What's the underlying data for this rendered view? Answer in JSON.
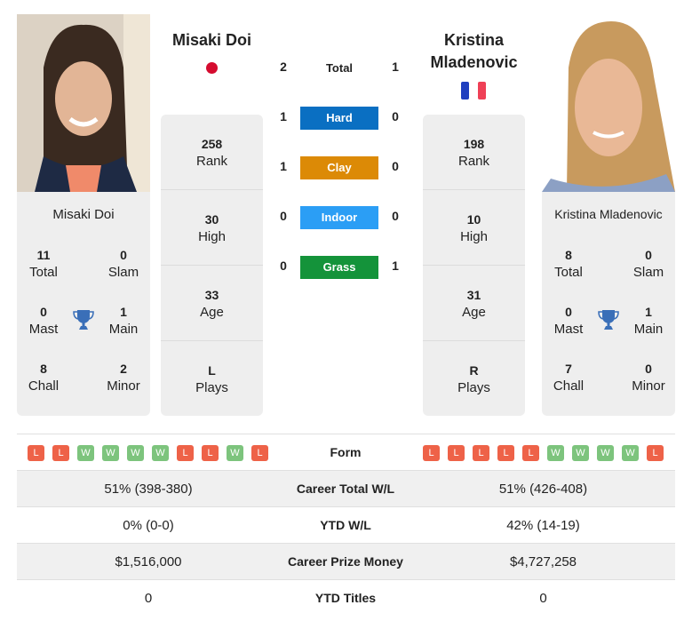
{
  "players": [
    {
      "name": "Misaki Doi",
      "header_name_lines": [
        "Misaki Doi"
      ],
      "flag": "japan-flag",
      "stats": {
        "rank": "258",
        "high": "30",
        "age": "33",
        "plays": "L"
      },
      "titles": {
        "total": "11",
        "slam": "0",
        "mast": "0",
        "main": "1",
        "chall": "8",
        "minor": "2"
      },
      "form": [
        "L",
        "L",
        "W",
        "W",
        "W",
        "W",
        "L",
        "L",
        "W",
        "L"
      ],
      "career_wl": "51% (398-380)",
      "ytd_wl": "0% (0-0)",
      "prize": "$1,516,000",
      "ytd_titles": "0"
    },
    {
      "name": "Kristina Mladenovic",
      "header_name_lines": [
        "Kristina",
        "Mladenovic"
      ],
      "flag": "france-flag",
      "stats": {
        "rank": "198",
        "high": "10",
        "age": "31",
        "plays": "R"
      },
      "titles": {
        "total": "8",
        "slam": "0",
        "mast": "0",
        "main": "1",
        "chall": "7",
        "minor": "0"
      },
      "form": [
        "L",
        "L",
        "L",
        "L",
        "L",
        "W",
        "W",
        "W",
        "W",
        "L"
      ],
      "career_wl": "51% (426-408)",
      "ytd_wl": "42% (14-19)",
      "prize": "$4,727,258",
      "ytd_titles": "0"
    }
  ],
  "labels": {
    "rank": "Rank",
    "high": "High",
    "age": "Age",
    "plays": "Plays",
    "total": "Total",
    "slam": "Slam",
    "mast": "Mast",
    "main": "Main",
    "chall": "Chall",
    "minor": "Minor"
  },
  "h2h": [
    {
      "label": "Total",
      "left": "2",
      "right": "1",
      "color": null
    },
    {
      "label": "Hard",
      "left": "1",
      "right": "0",
      "color": "#0a6fc2"
    },
    {
      "label": "Clay",
      "left": "1",
      "right": "0",
      "color": "#dc8a06"
    },
    {
      "label": "Indoor",
      "left": "0",
      "right": "0",
      "color": "#2b9ef5"
    },
    {
      "label": "Grass",
      "left": "0",
      "right": "1",
      "color": "#14933a"
    }
  ],
  "comparison": {
    "form_label": "Form",
    "career_wl_label": "Career Total W/L",
    "ytd_wl_label": "YTD W/L",
    "prize_label": "Career Prize Money",
    "ytd_titles_label": "YTD Titles"
  },
  "colors": {
    "win": "#7dc47d",
    "loss": "#ee6248",
    "trophy": "#3a6fb8",
    "card": "#eeeeee"
  }
}
